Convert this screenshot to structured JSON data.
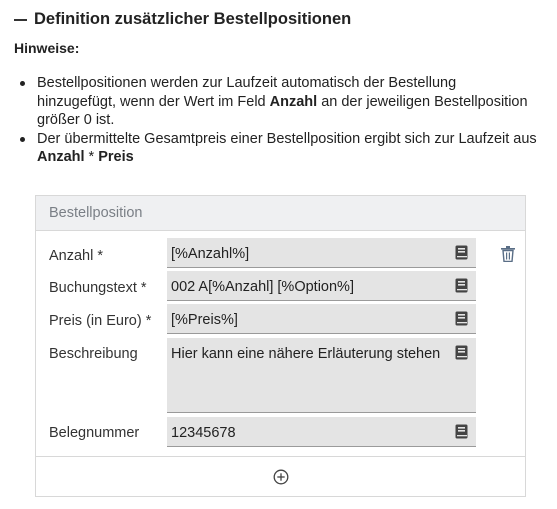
{
  "section": {
    "title": "Definition zusätzlicher Bestellpositionen"
  },
  "hints": {
    "title": "Hinweise:",
    "item1": {
      "pre": "Bestellpositionen werden zur Laufzeit automatisch der Bestellung hinzugefügt, wenn der Wert im Feld ",
      "bold": "Anzahl",
      "post": " an der jeweiligen Bestellposition größer 0 ist."
    },
    "item2": {
      "pre": "Der übermittelte Gesamtpreis einer Bestellposition ergibt sich zur Laufzeit aus ",
      "bold1": "Anzahl",
      "mid": " * ",
      "bold2": "Preis"
    }
  },
  "panel": {
    "title": "Bestellposition",
    "fields": [
      {
        "label": "Anzahl *",
        "value": "[%Anzahl%]"
      },
      {
        "label": "Buchungstext *",
        "value": "002 A[%Anzahl] [%Option%]"
      },
      {
        "label": "Preis (in Euro) *",
        "value": "[%Preis%]"
      },
      {
        "label": "Beschreibung",
        "value": "Hier kann eine nähere Erläuterung stehen"
      },
      {
        "label": "Belegnummer",
        "value": "12345678"
      }
    ]
  },
  "icons": {
    "collapse": "minus-dash-icon",
    "field_action": "book-icon",
    "delete": "trash-icon",
    "add": "plus-circle-icon"
  },
  "colors": {
    "panel_header_bg": "#eff0f2",
    "field_bg": "#e4e4e4",
    "icon_color": "#444444"
  }
}
